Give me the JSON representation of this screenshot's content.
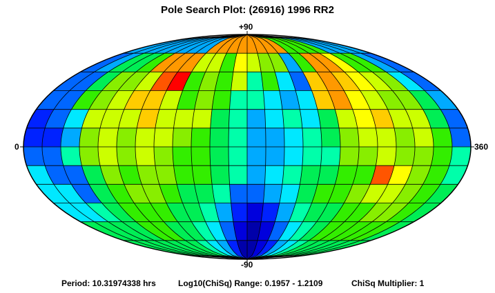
{
  "chart_data": {
    "type": "heatmap",
    "projection": "mollweide-like ellipse",
    "title": "Pole Search Plot: (26916) 1996 RR2",
    "top_label": "+90",
    "bottom_label": "-90",
    "left_label": "0",
    "right_label": "360",
    "x_range": [
      0,
      360
    ],
    "y_range": [
      -90,
      90
    ],
    "columns": 24,
    "rows": 12,
    "colors": {
      "0": "#0000aa",
      "1": "#0000dd",
      "2": "#0022ff",
      "3": "#0066ff",
      "4": "#00aaff",
      "5": "#00e8ff",
      "6": "#00ffaa",
      "7": "#00ee55",
      "8": "#33ee00",
      "9": "#88ee00",
      "10": "#ccff00",
      "11": "#ffff00",
      "12": "#ffcc00",
      "13": "#ff9900",
      "14": "#ff5500",
      "15": "#ff0000"
    },
    "grid": [
      [
        4,
        4,
        4,
        4,
        4,
        4,
        4,
        4,
        13,
        13,
        13,
        13,
        13,
        13,
        13,
        13,
        8,
        8,
        8,
        8,
        4,
        4,
        4,
        4
      ],
      [
        3,
        4,
        7,
        7,
        8,
        13,
        13,
        13,
        10,
        10,
        8,
        11,
        10,
        9,
        9,
        4,
        8,
        13,
        13,
        11,
        8,
        8,
        4,
        3
      ],
      [
        3,
        3,
        7,
        9,
        9,
        10,
        14,
        15,
        8,
        9,
        8,
        10,
        6,
        8,
        5,
        3,
        12,
        13,
        12,
        11,
        10,
        9,
        5,
        3
      ],
      [
        3,
        3,
        8,
        9,
        10,
        12,
        12,
        10,
        8,
        9,
        8,
        6,
        6,
        5,
        4,
        5,
        12,
        13,
        11,
        10,
        9,
        9,
        7,
        4
      ],
      [
        2,
        3,
        5,
        10,
        10,
        10,
        12,
        10,
        10,
        10,
        7,
        6,
        4,
        5,
        6,
        5,
        7,
        10,
        11,
        12,
        10,
        10,
        7,
        3
      ],
      [
        2,
        2,
        4,
        9,
        10,
        9,
        10,
        10,
        9,
        8,
        7,
        6,
        4,
        4,
        5,
        6,
        7,
        9,
        10,
        10,
        9,
        10,
        8,
        3
      ],
      [
        3,
        3,
        6,
        9,
        10,
        9,
        10,
        9,
        8,
        8,
        7,
        6,
        4,
        4,
        5,
        6,
        6,
        9,
        9,
        10,
        9,
        9,
        8,
        6
      ],
      [
        5,
        3,
        3,
        7,
        9,
        8,
        9,
        9,
        8,
        8,
        7,
        6,
        4,
        5,
        6,
        7,
        7,
        8,
        8,
        14,
        11,
        9,
        8,
        6
      ],
      [
        5,
        5,
        3,
        7,
        8,
        9,
        9,
        8,
        7,
        7,
        6,
        3,
        3,
        4,
        5,
        7,
        8,
        8,
        9,
        10,
        10,
        9,
        8,
        7
      ],
      [
        5,
        5,
        6,
        7,
        8,
        8,
        8,
        7,
        7,
        6,
        4,
        2,
        1,
        2,
        4,
        6,
        7,
        7,
        8,
        8,
        9,
        9,
        8,
        7
      ],
      [
        7,
        7,
        7,
        7,
        8,
        8,
        7,
        7,
        6,
        5,
        3,
        1,
        0,
        1,
        3,
        5,
        6,
        7,
        8,
        8,
        8,
        8,
        8,
        7
      ],
      [
        7,
        7,
        7,
        7,
        7,
        7,
        7,
        6,
        5,
        4,
        2,
        0,
        0,
        1,
        2,
        4,
        5,
        6,
        7,
        7,
        7,
        7,
        7,
        7
      ]
    ]
  },
  "footer": {
    "period": "Period: 10.31974338 hrs",
    "range": "Log10(ChiSq) Range: 0.1957 - 1.2109",
    "multiplier": "ChiSq Multiplier: 1"
  }
}
